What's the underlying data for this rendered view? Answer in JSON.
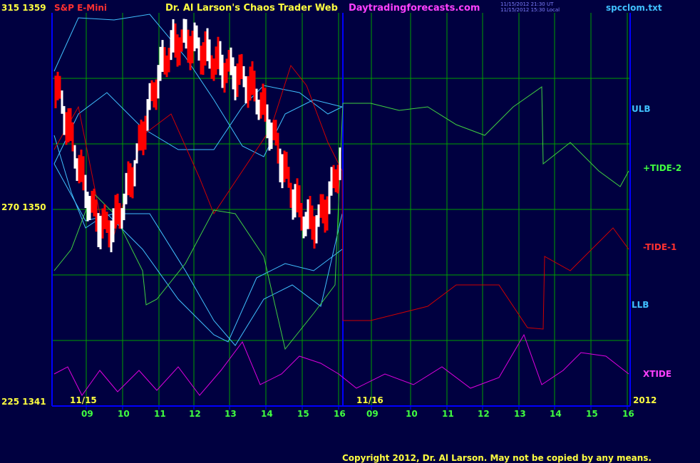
{
  "header": {
    "top_scale": "315  1359",
    "instrument": "S&P E-Mini",
    "title": "Dr. Al Larson's Chaos Trader Web",
    "site": "Daytradingforecasts.com",
    "timestamp1": "11/15/2012 21:30 UT",
    "timestamp2": "11/15/2012 15:30 Local",
    "file": "spcclom.txt"
  },
  "left_scale": {
    "mid": "270  1350",
    "bottom": "225  1341"
  },
  "right_labels": {
    "ulb": "ULB",
    "tide2": "+TIDE-2",
    "tide1": "-TIDE-1",
    "llb": "LLB",
    "xtide": "XTIDE",
    "year": "2012"
  },
  "date_labels": {
    "d1": "11/15",
    "d2": "11/16"
  },
  "hour_labels": [
    "09",
    "10",
    "11",
    "12",
    "13",
    "14",
    "15",
    "16",
    "09",
    "10",
    "11",
    "12",
    "13",
    "14",
    "15",
    "16"
  ],
  "footer": "Copyright 2012, Dr. Al Larson. May not be copied by any means.",
  "colors": {
    "bg": "#000040",
    "grid": "#00a000",
    "axis": "#0000ff",
    "price_up": "#ffffff",
    "price_down": "#ff0000",
    "ma": "#ffff00",
    "band": "#40c0ff",
    "tide1": "#d00000",
    "tide2": "#40d040",
    "xtide": "#e000e0"
  },
  "chart_data": {
    "type": "line",
    "y_scale_labels": [
      "1359",
      "1350",
      "1341"
    ],
    "series": [
      {
        "name": "ULB"
      },
      {
        "name": "LLB"
      },
      {
        "name": "+TIDE-2"
      },
      {
        "name": "-TIDE-1"
      },
      {
        "name": "XTIDE"
      }
    ]
  }
}
